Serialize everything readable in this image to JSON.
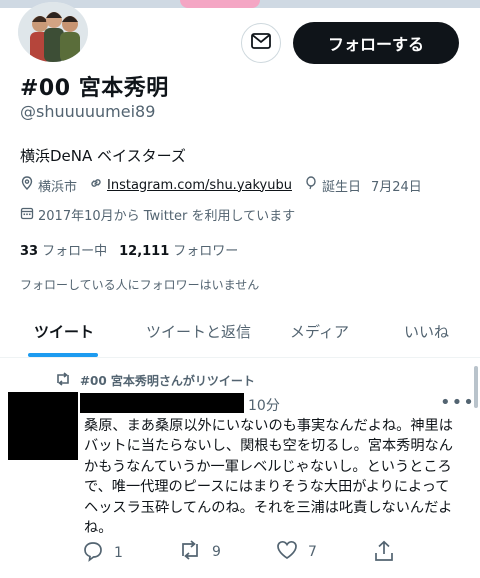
{
  "profile": {
    "follow_label": "フォローする",
    "name": "#00 宮本秀明",
    "handle": "@shuuuuumei89",
    "bio": "横浜DeNA ベイスターズ",
    "location": "横浜市",
    "website": "Instagram.com/shu.yakyubu",
    "birthday_label": "誕生日",
    "birthday": "7月24日",
    "joined": "2017年10月から Twitter を利用しています",
    "following_count": "33",
    "following_label": "フォロー中",
    "followers_count": "12,111",
    "followers_label": "フォロワー",
    "no_mutual": "フォローしている人にフォロワーはいません"
  },
  "tabs": [
    {
      "label": "ツイート"
    },
    {
      "label": "ツイートと返信"
    },
    {
      "label": "メディア"
    },
    {
      "label": "いいね"
    }
  ],
  "tweet": {
    "retweet_label": "#00 宮本秀明さんがリツイート",
    "time": "10分",
    "more": "•••",
    "lines": [
      "桑原、まあ桑原以外にいないのも事実なんだよね。神里は",
      "バットに当たらないし、関根も空を切るし。宮本秀明なん",
      "かもうなんていうか一軍レベルじゃないし。というところ",
      "で、唯一代理のピースにはまりそうな大田がよりによって",
      "ヘッスラ玉砕してんのね。それを三浦は叱責しないんだよ",
      "ね。"
    ],
    "replies": "1",
    "retweets": "9",
    "likes": "7"
  },
  "icons": {
    "message": "mail-icon",
    "location": "location-pin-icon",
    "link": "link-icon",
    "birthday": "balloon-icon",
    "joined": "calendar-icon",
    "retweet": "retweet-icon",
    "reply": "reply-icon",
    "like": "heart-icon",
    "share": "share-icon"
  },
  "colors": {
    "accent": "#1d9bf0",
    "text": "#0f1419",
    "muted": "#536471",
    "button": "#0f1419"
  }
}
